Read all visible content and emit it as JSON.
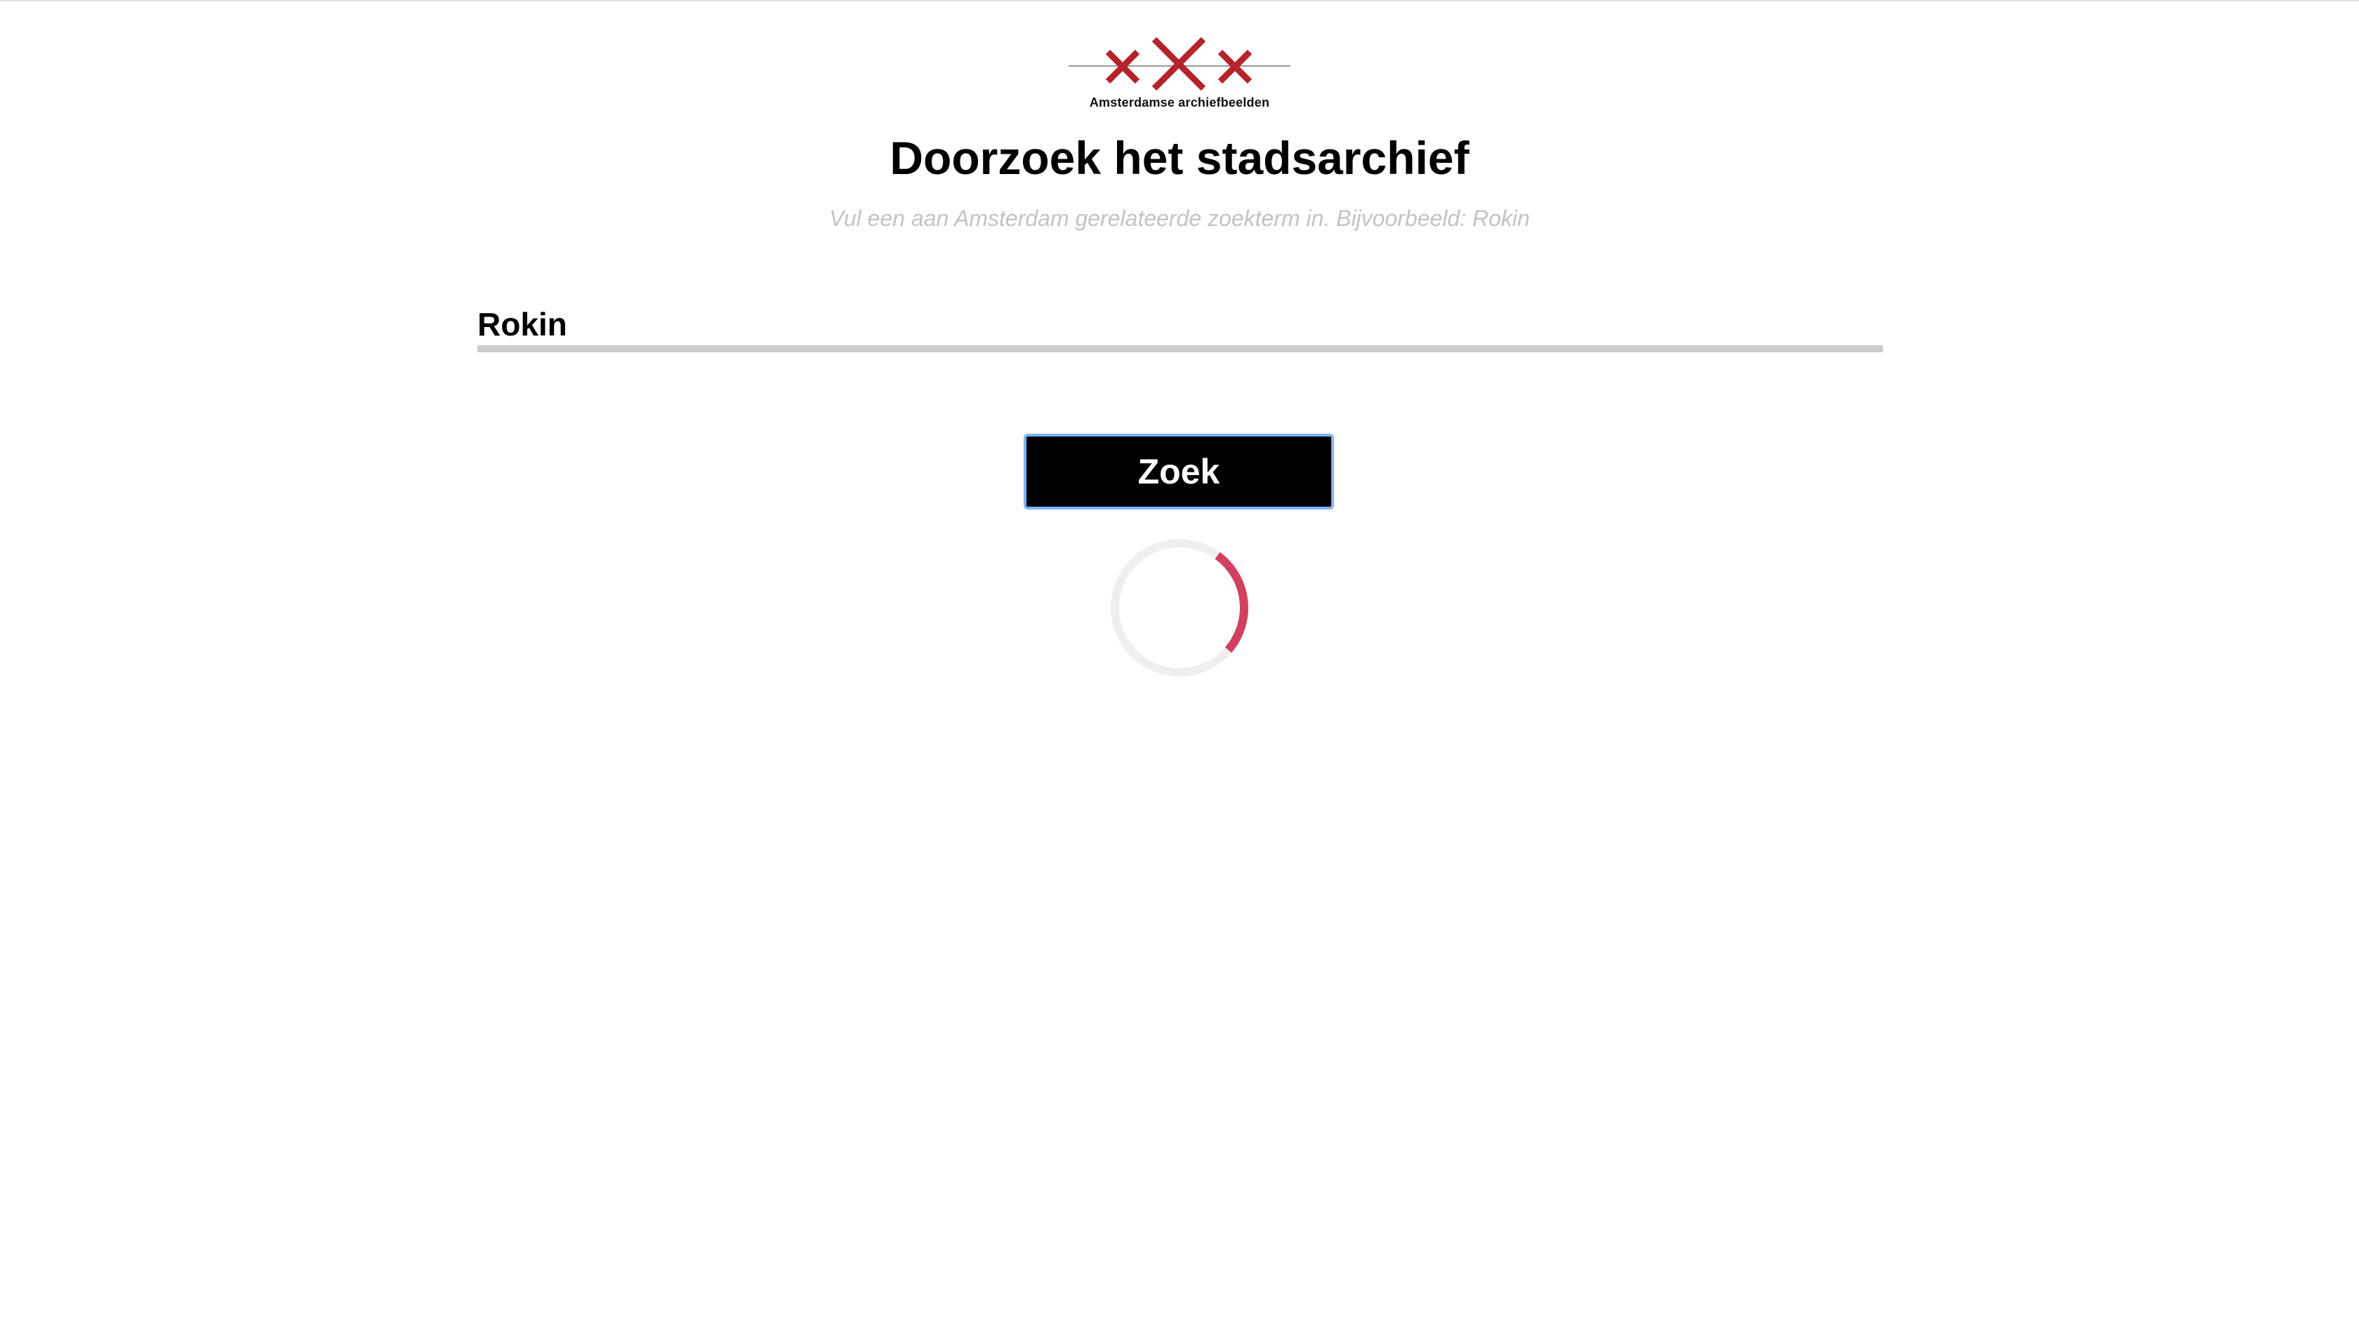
{
  "logo": {
    "text": "Amsterdamse archiefbeelden",
    "color": "#b5242b"
  },
  "page": {
    "title": "Doorzoek het stadsarchief",
    "subtitle": "Vul een aan Amsterdam gerelateerde zoekterm in. Bijvoorbeeld: Rokin"
  },
  "search": {
    "value": "Rokin",
    "button_label": "Zoek"
  },
  "loading": {
    "active": true,
    "accent_color": "#d1405f"
  }
}
